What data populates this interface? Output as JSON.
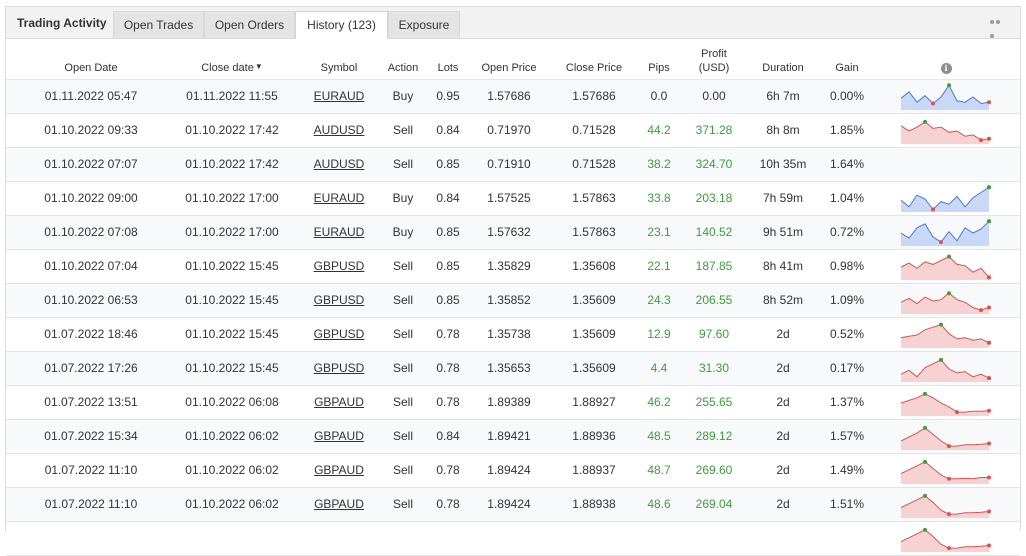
{
  "tabs": {
    "title": "Trading Activity",
    "items": [
      {
        "label": "Open Trades"
      },
      {
        "label": "Open Orders"
      },
      {
        "label": "History (123)"
      },
      {
        "label": "Exposure"
      }
    ]
  },
  "columns": {
    "open_date": "Open Date",
    "close_date": "Close date",
    "symbol": "Symbol",
    "action": "Action",
    "lots": "Lots",
    "open_price": "Open Price",
    "close_price": "Close Price",
    "pips": "Pips",
    "profit_line1": "Profit",
    "profit_line2": "(USD)",
    "duration": "Duration",
    "gain": "Gain"
  },
  "colors": {
    "positive": "#3aa13a",
    "buy_line": "#4a78d6",
    "buy_fill": "#c9d8f5",
    "sell_line": "#d9534f",
    "sell_fill": "#f6d3d2",
    "marker_high": "#3aa13a",
    "marker_low": "#e0504d"
  },
  "rows": [
    {
      "open_date": "01.11.2022 05:47",
      "close_date": "01.11.2022 11:55",
      "symbol": "EURAUD",
      "action": "Buy",
      "lots": "0.95",
      "open_price": "1.57686",
      "close_price": "1.57686",
      "pips": "0.0",
      "profit": "0.00",
      "duration": "6h 7m",
      "gain": "0.00%",
      "positive": false,
      "spark": [
        0.45,
        0.7,
        0.3,
        0.55,
        0.25,
        0.5,
        0.95,
        0.35,
        0.3,
        0.5,
        0.25,
        0.3
      ]
    },
    {
      "open_date": "01.10.2022 09:33",
      "close_date": "01.10.2022 17:42",
      "symbol": "AUDUSD",
      "action": "Sell",
      "lots": "0.84",
      "open_price": "0.71970",
      "close_price": "0.71528",
      "pips": "44.2",
      "profit": "371.28",
      "duration": "8h 8m",
      "gain": "1.85%",
      "positive": true,
      "spark": [
        0.7,
        0.5,
        0.65,
        0.85,
        0.6,
        0.65,
        0.45,
        0.5,
        0.3,
        0.35,
        0.15,
        0.2
      ]
    },
    {
      "open_date": "01.10.2022 07:07",
      "close_date": "01.10.2022 17:42",
      "symbol": "AUDUSD",
      "action": "Sell",
      "lots": "0.85",
      "open_price": "0.71910",
      "close_price": "0.71528",
      "pips": "38.2",
      "profit": "324.70",
      "duration": "10h 35m",
      "gain": "1.64%",
      "positive": true,
      "spark": []
    },
    {
      "open_date": "01.10.2022 09:00",
      "close_date": "01.10.2022 17:00",
      "symbol": "EURAUD",
      "action": "Buy",
      "lots": "0.84",
      "open_price": "1.57525",
      "close_price": "1.57863",
      "pips": "33.8",
      "profit": "203.18",
      "duration": "7h 59m",
      "gain": "1.04%",
      "positive": true,
      "spark": [
        0.45,
        0.2,
        0.65,
        0.5,
        0.1,
        0.4,
        0.3,
        0.6,
        0.2,
        0.55,
        0.75,
        0.95
      ]
    },
    {
      "open_date": "01.10.2022 07:08",
      "close_date": "01.10.2022 17:00",
      "symbol": "EURAUD",
      "action": "Buy",
      "lots": "0.85",
      "open_price": "1.57632",
      "close_price": "1.57863",
      "pips": "23.1",
      "profit": "140.52",
      "duration": "9h 51m",
      "gain": "0.72%",
      "positive": true,
      "spark": [
        0.5,
        0.3,
        0.7,
        0.85,
        0.35,
        0.15,
        0.55,
        0.2,
        0.7,
        0.5,
        0.65,
        0.95
      ]
    },
    {
      "open_date": "01.10.2022 07:04",
      "close_date": "01.10.2022 15:45",
      "symbol": "GBPUSD",
      "action": "Sell",
      "lots": "0.85",
      "open_price": "1.35829",
      "close_price": "1.35608",
      "pips": "22.1",
      "profit": "187.85",
      "duration": "8h 41m",
      "gain": "0.98%",
      "positive": true,
      "spark": [
        0.5,
        0.65,
        0.45,
        0.7,
        0.6,
        0.75,
        0.9,
        0.6,
        0.55,
        0.3,
        0.45,
        0.1
      ]
    },
    {
      "open_date": "01.10.2022 06:53",
      "close_date": "01.10.2022 15:45",
      "symbol": "GBPUSD",
      "action": "Sell",
      "lots": "0.85",
      "open_price": "1.35852",
      "close_price": "1.35609",
      "pips": "24.3",
      "profit": "206.55",
      "duration": "8h 52m",
      "gain": "1.09%",
      "positive": true,
      "spark": [
        0.45,
        0.6,
        0.4,
        0.65,
        0.5,
        0.55,
        0.8,
        0.55,
        0.45,
        0.25,
        0.15,
        0.25
      ]
    },
    {
      "open_date": "01.07.2022 18:46",
      "close_date": "01.10.2022 15:45",
      "symbol": "GBPUSD",
      "action": "Sell",
      "lots": "0.78",
      "open_price": "1.35738",
      "close_price": "1.35609",
      "pips": "12.9",
      "profit": "97.60",
      "duration": "2d",
      "gain": "0.52%",
      "positive": true,
      "spark": [
        0.4,
        0.45,
        0.5,
        0.7,
        0.8,
        0.9,
        0.55,
        0.35,
        0.4,
        0.3,
        0.35,
        0.2
      ]
    },
    {
      "open_date": "01.07.2022 17:26",
      "close_date": "01.10.2022 15:45",
      "symbol": "GBPUSD",
      "action": "Sell",
      "lots": "0.78",
      "open_price": "1.35653",
      "close_price": "1.35609",
      "pips": "4.4",
      "profit": "31.30",
      "duration": "2d",
      "gain": "0.17%",
      "positive": true,
      "spark": [
        0.3,
        0.45,
        0.2,
        0.55,
        0.7,
        0.85,
        0.5,
        0.35,
        0.4,
        0.2,
        0.3,
        0.15
      ]
    },
    {
      "open_date": "01.07.2022 13:51",
      "close_date": "01.10.2022 06:08",
      "symbol": "GBPAUD",
      "action": "Sell",
      "lots": "0.78",
      "open_price": "1.89389",
      "close_price": "1.88927",
      "pips": "46.2",
      "profit": "255.65",
      "duration": "2d",
      "gain": "1.37%",
      "positive": true,
      "spark": [
        0.5,
        0.6,
        0.7,
        0.85,
        0.7,
        0.5,
        0.35,
        0.15,
        0.15,
        0.18,
        0.18,
        0.2
      ]
    },
    {
      "open_date": "01.07.2022 15:34",
      "close_date": "01.10.2022 06:02",
      "symbol": "GBPAUD",
      "action": "Sell",
      "lots": "0.84",
      "open_price": "1.89421",
      "close_price": "1.88936",
      "pips": "48.5",
      "profit": "289.12",
      "duration": "2d",
      "gain": "1.57%",
      "positive": true,
      "spark": [
        0.35,
        0.5,
        0.65,
        0.85,
        0.6,
        0.35,
        0.15,
        0.15,
        0.2,
        0.2,
        0.22,
        0.25
      ]
    },
    {
      "open_date": "01.07.2022 11:10",
      "close_date": "01.10.2022 06:02",
      "symbol": "GBPAUD",
      "action": "Sell",
      "lots": "0.78",
      "open_price": "1.89424",
      "close_price": "1.88937",
      "pips": "48.7",
      "profit": "269.60",
      "duration": "2d",
      "gain": "1.49%",
      "positive": true,
      "spark": [
        0.4,
        0.55,
        0.7,
        0.85,
        0.6,
        0.35,
        0.2,
        0.2,
        0.22,
        0.2,
        0.25,
        0.25
      ]
    },
    {
      "open_date": "01.07.2022 11:10",
      "close_date": "01.10.2022 06:02",
      "symbol": "GBPAUD",
      "action": "Sell",
      "lots": "0.78",
      "open_price": "1.89424",
      "close_price": "1.88938",
      "pips": "48.6",
      "profit": "269.04",
      "duration": "2d",
      "gain": "1.51%",
      "positive": true,
      "spark": [
        0.4,
        0.55,
        0.7,
        0.85,
        0.6,
        0.3,
        0.15,
        0.15,
        0.2,
        0.2,
        0.22,
        0.25
      ]
    },
    {
      "open_date": "",
      "close_date": "",
      "symbol": "",
      "action": "",
      "lots": "",
      "open_price": "",
      "close_price": "",
      "pips": "",
      "profit": "",
      "duration": "",
      "gain": "",
      "positive": true,
      "spark": [
        0.4,
        0.55,
        0.7,
        0.85,
        0.6,
        0.3,
        0.15,
        0.15,
        0.2,
        0.2,
        0.22,
        0.25
      ]
    }
  ]
}
